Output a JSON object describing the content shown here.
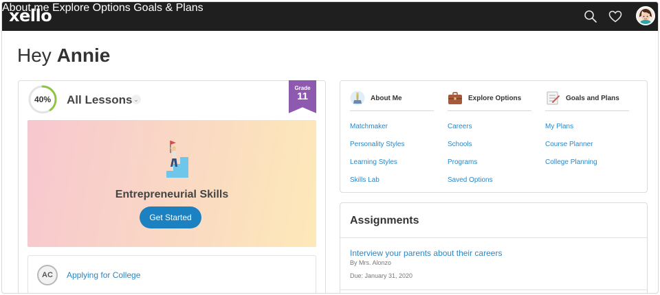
{
  "header": {
    "logo": "xello",
    "nav": [
      "About me",
      "Explore Options",
      "Goals & Plans"
    ],
    "icons": [
      "search-icon",
      "heart-icon",
      "avatar"
    ]
  },
  "greeting": {
    "prefix": "Hey",
    "name": "Annie"
  },
  "lessons": {
    "progress_text": "40%",
    "progress_value": 0.4,
    "title": "All Lessons",
    "grade_label": "Grade",
    "grade_number": "11",
    "hero_title": "Entrepreneurial Skills",
    "hero_button": "Get Started",
    "next_lesson": {
      "badge": "AC",
      "label": "Applying for College"
    }
  },
  "quicknav": {
    "columns": [
      {
        "title": "About Me",
        "icon": "trophy-icon",
        "links": [
          "Matchmaker",
          "Personality Styles",
          "Learning Styles",
          "Skills Lab"
        ]
      },
      {
        "title": "Explore Options",
        "icon": "briefcase-icon",
        "links": [
          "Careers",
          "Schools",
          "Programs",
          "Saved Options"
        ]
      },
      {
        "title": "Goals and Plans",
        "icon": "checklist-icon",
        "links": [
          "My Plans",
          "Course Planner",
          "College Planning"
        ]
      }
    ]
  },
  "assignments": {
    "title": "Assignments",
    "items": [
      {
        "title": "Interview your parents about their careers",
        "by": "By Mrs. Alonzo",
        "due": "Due: January 31, 2020"
      }
    ]
  },
  "colors": {
    "topbar": "#1f1f1f",
    "accent_blue": "#1c81c0",
    "link": "#2a86c4",
    "grade_purple": "#8e5ab0",
    "progress_green": "#8cc63f"
  }
}
